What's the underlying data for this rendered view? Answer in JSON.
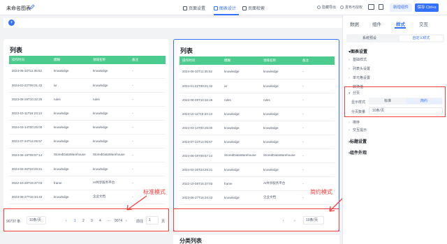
{
  "topbar": {
    "title": "未命名图表",
    "tabs": [
      {
        "label": "页面设置"
      },
      {
        "label": "图表设计"
      },
      {
        "label": "页面检索"
      }
    ],
    "hide_label": "隐藏导出",
    "share_label": "发布与授权",
    "new_label": "新增组件",
    "save_label": "保存 Ctrl+s"
  },
  "left_card": {
    "title": "列表",
    "columns": [
      "操作时间",
      "模糊",
      "领域名称",
      "备注"
    ],
    "rows": [
      [
        "2024-05-10T11:35:52",
        "knowledge",
        "knowledge",
        "-"
      ],
      [
        "2024-01-22T09:21:42",
        "ivr",
        "knowledge",
        "-"
      ],
      [
        "2023-08-29T10:32:26",
        "rules",
        "rules",
        "-"
      ],
      [
        "2023-10-11T15:23:13",
        "knowledge",
        "knowledge",
        "-"
      ],
      [
        "2024-03-14T00:25:00",
        "knowledge",
        "knowledge",
        "-"
      ],
      [
        "2023-07-24T14:05:57",
        "knowledge",
        "knowledge",
        "-"
      ],
      [
        "2024-06-19T09:57:14",
        "StoredDataWarehouse",
        "StoredDataWarehouse",
        "-"
      ],
      [
        "2024-02-26T23:26:21",
        "knowledge",
        "knowledge",
        "-"
      ],
      [
        "2022-10-28T15:37:03",
        "frame",
        "AI共享服务平台",
        "-"
      ],
      [
        "2023-06-27T15:34:43",
        "knowledge",
        "企业文档",
        "-"
      ]
    ],
    "pager": {
      "total": "90737 条",
      "page_size": "10条/页",
      "pages": [
        "1",
        "2",
        "3",
        "4",
        "···",
        "9074"
      ],
      "goto_label": "前往",
      "goto_value": "1",
      "goto_suffix": "页"
    }
  },
  "right_card": {
    "title": "列表",
    "pager": {
      "page_size": "10条/页"
    }
  },
  "callouts": {
    "standard": "标准模式",
    "simple": "简约模式"
  },
  "bottom_card": {
    "title": "分类列表"
  },
  "panel": {
    "tabs": [
      "数据",
      "组件",
      "样式",
      "交互"
    ],
    "active_tab": "样式",
    "segment": [
      "系统预设",
      "自定义样式"
    ],
    "section_chart": "图表设置",
    "items_top": [
      "基础样式",
      "列表头设置",
      "单元格设置",
      "转换值"
    ],
    "pager_section": "分页",
    "display_mode_label": "显示样式",
    "display_modes": [
      "标准",
      "简约"
    ],
    "page_count_label": "分页数量",
    "page_count_value": "10条/页",
    "items_bottom": [
      "排序",
      "交互提示"
    ],
    "section_common": "标题设置",
    "section_component": "组件外观"
  },
  "colors": {
    "accent": "#3370ff",
    "header_green": "#4bcb8d",
    "highlight_red": "#f53f3f"
  }
}
